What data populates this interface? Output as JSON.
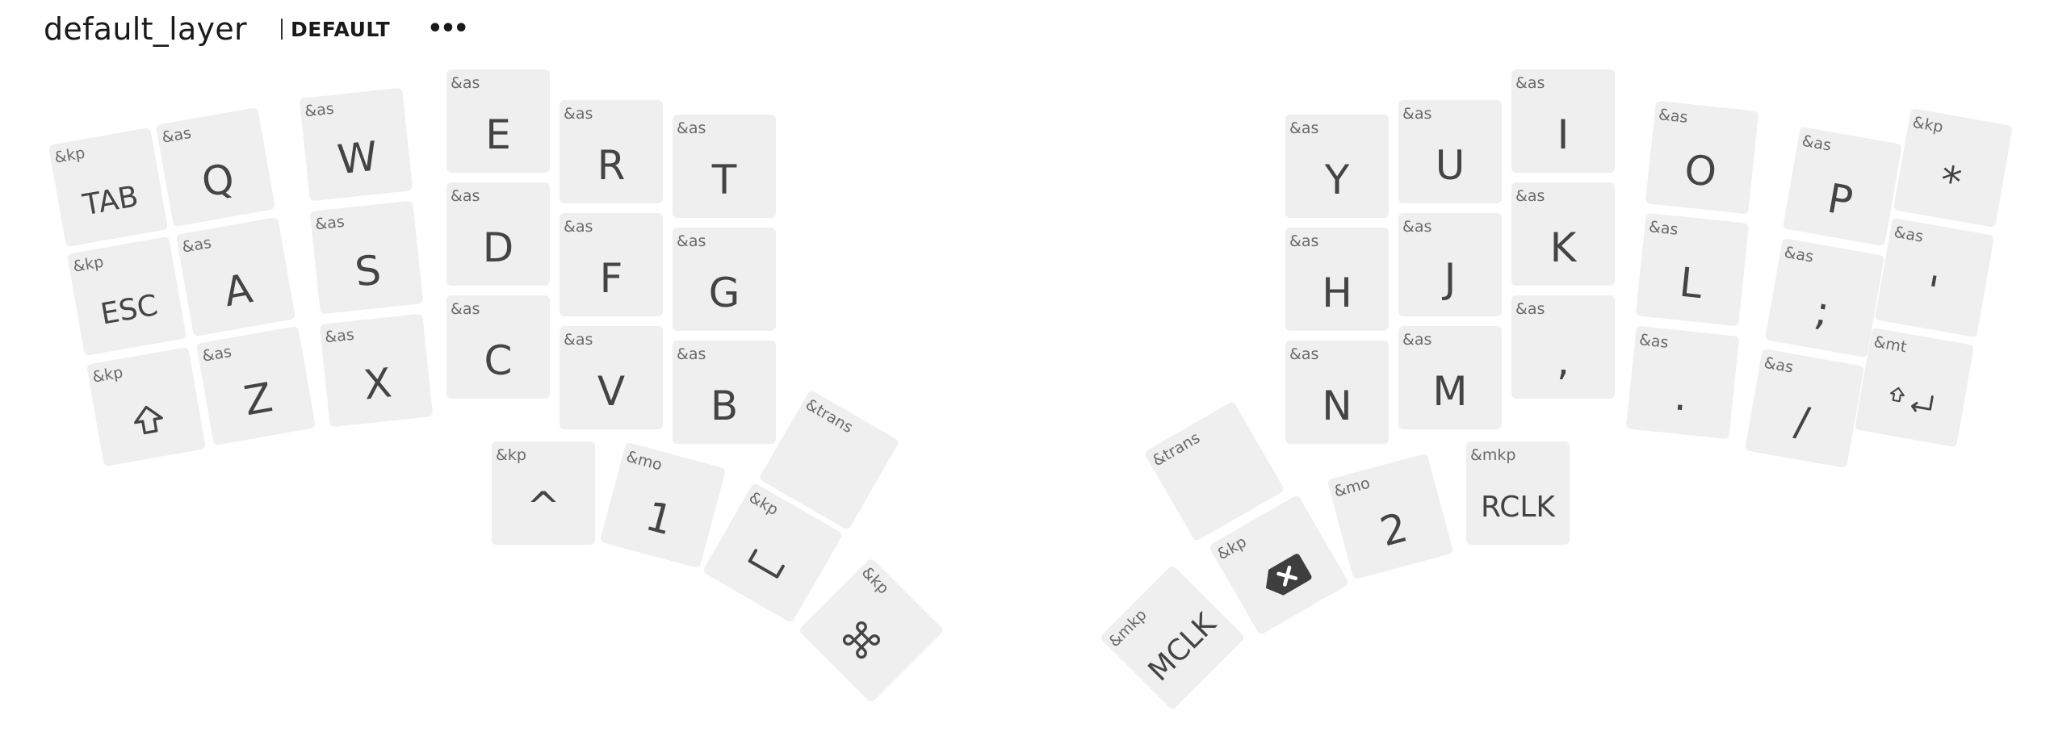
{
  "header": {
    "layer_name": "default_layer",
    "layer_tag": "DEFAULT",
    "menu_icon": "more-horizontal-icon",
    "menu_glyph": "•••"
  },
  "colors": {
    "key_background": "#efefef",
    "legend": "#444444",
    "behavior": "#6a6a6a"
  },
  "left_keys": [
    {
      "behavior": "&kp",
      "legend": "TAB"
    },
    {
      "behavior": "&as",
      "legend": "Q"
    },
    {
      "behavior": "&as",
      "legend": "W"
    },
    {
      "behavior": "&as",
      "legend": "E"
    },
    {
      "behavior": "&as",
      "legend": "R"
    },
    {
      "behavior": "&as",
      "legend": "T"
    },
    {
      "behavior": "&kp",
      "legend": "ESC"
    },
    {
      "behavior": "&as",
      "legend": "A"
    },
    {
      "behavior": "&as",
      "legend": "S"
    },
    {
      "behavior": "&as",
      "legend": "D"
    },
    {
      "behavior": "&as",
      "legend": "F"
    },
    {
      "behavior": "&as",
      "legend": "G"
    },
    {
      "behavior": "&kp",
      "legend": "",
      "icon": "shift-icon"
    },
    {
      "behavior": "&as",
      "legend": "Z"
    },
    {
      "behavior": "&as",
      "legend": "X"
    },
    {
      "behavior": "&as",
      "legend": "C"
    },
    {
      "behavior": "&as",
      "legend": "V"
    },
    {
      "behavior": "&as",
      "legend": "B"
    }
  ],
  "left_thumbs": [
    {
      "behavior": "&kp",
      "legend": "^"
    },
    {
      "behavior": "&mo",
      "legend": "1"
    },
    {
      "behavior": "&kp",
      "legend": "",
      "icon": "space-bar-icon"
    },
    {
      "behavior": "&trans",
      "legend": ""
    },
    {
      "behavior": "&kp",
      "legend": "",
      "icon": "command-icon"
    }
  ],
  "right_keys": [
    {
      "behavior": "&as",
      "legend": "Y"
    },
    {
      "behavior": "&as",
      "legend": "U"
    },
    {
      "behavior": "&as",
      "legend": "I"
    },
    {
      "behavior": "&as",
      "legend": "O"
    },
    {
      "behavior": "&as",
      "legend": "P"
    },
    {
      "behavior": "&kp",
      "legend": "*"
    },
    {
      "behavior": "&as",
      "legend": "H"
    },
    {
      "behavior": "&as",
      "legend": "J"
    },
    {
      "behavior": "&as",
      "legend": "K"
    },
    {
      "behavior": "&as",
      "legend": "L"
    },
    {
      "behavior": "&as",
      "legend": ";"
    },
    {
      "behavior": "&as",
      "legend": "'"
    },
    {
      "behavior": "&as",
      "legend": "N"
    },
    {
      "behavior": "&as",
      "legend": "M"
    },
    {
      "behavior": "&as",
      "legend": ","
    },
    {
      "behavior": "&as",
      "legend": "."
    },
    {
      "behavior": "&as",
      "legend": "/"
    },
    {
      "behavior": "&mt",
      "legend": "",
      "icon": "shift-enter-icon"
    }
  ],
  "right_thumbs": [
    {
      "behavior": "&trans",
      "legend": ""
    },
    {
      "behavior": "&mo",
      "legend": "2"
    },
    {
      "behavior": "&mkp",
      "legend": "RCLK"
    },
    {
      "behavior": "&kp",
      "legend": "",
      "icon": "backspace-icon"
    },
    {
      "behavior": "&mkp",
      "legend": "MCLK"
    }
  ]
}
